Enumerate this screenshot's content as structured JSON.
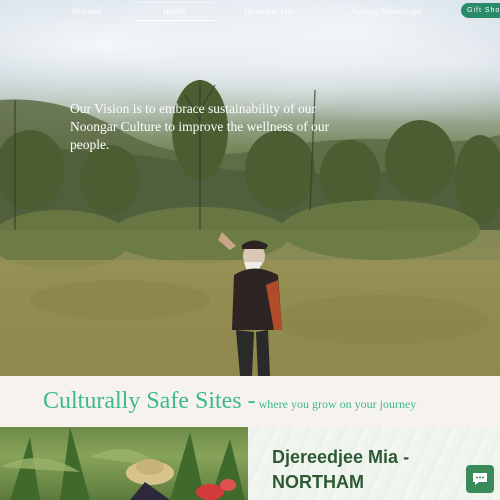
{
  "nav": {
    "items": [
      "Welcome",
      "HOME",
      "Djereedjee Mia",
      "Nyitting NatureScape"
    ],
    "active": "HOME",
    "gift_label": "Gift Sho"
  },
  "hero": {
    "vision_text": "Our Vision is to embrace sustainability of our Noongar Culture to improve the wellness of our people."
  },
  "banner": {
    "main": "Culturally Safe Sites -",
    "sub": " where you grow on your journey"
  },
  "panel": {
    "title": "Djereedjee Mia - NORTHAM"
  },
  "colors": {
    "accent": "#3fb88c",
    "gift_button": "#2a8a6a",
    "panel_title": "#2d5a35",
    "chat_button": "#3b8a5a"
  },
  "icons": {
    "chat": "chat-bubble-icon"
  }
}
